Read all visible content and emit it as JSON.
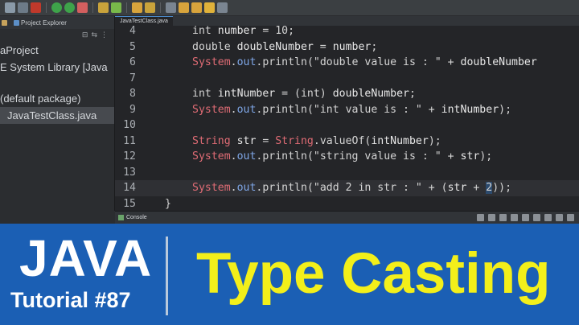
{
  "toolbar": {
    "icons": [
      "new-icon",
      "save-icon",
      "debug-icon",
      "run-icon",
      "external-tools-icon",
      "new-java-project-icon",
      "new-package-icon",
      "new-class-icon",
      "open-type-icon",
      "search-icon",
      "toggle-mark-icon",
      "next-annotation-icon",
      "prev-annotation-icon",
      "back-icon",
      "forward-icon"
    ]
  },
  "sidebar": {
    "tabs": [
      {
        "label": ""
      },
      {
        "label": "Project Explorer"
      }
    ],
    "items": [
      {
        "label": "aProject",
        "indent": 0,
        "selected": false
      },
      {
        "label": "E System Library [Java",
        "indent": 0,
        "selected": false
      },
      {
        "label": "(default package)",
        "indent": 0,
        "selected": false
      },
      {
        "label": "JavaTestClass.java",
        "indent": 1,
        "selected": true
      }
    ]
  },
  "editor": {
    "tab_label": "JavaTestClass.java",
    "lines": [
      {
        "n": "4",
        "parts": [
          [
            "int ",
            "kw"
          ],
          [
            "number",
            "var"
          ],
          [
            " = 10;",
            "kw"
          ]
        ]
      },
      {
        "n": "5",
        "parts": [
          [
            "double ",
            "kw"
          ],
          [
            "doubleNumber",
            "var"
          ],
          [
            " = ",
            "kw"
          ],
          [
            "number",
            "var"
          ],
          [
            ";",
            "kw"
          ]
        ]
      },
      {
        "n": "6",
        "parts": [
          [
            "System",
            "red"
          ],
          [
            ".",
            "kw"
          ],
          [
            "out",
            "blue"
          ],
          [
            ".println(\"double value is : \" + ",
            "kw"
          ],
          [
            "doubleNumber",
            "var"
          ]
        ]
      },
      {
        "n": "7",
        "parts": []
      },
      {
        "n": "8",
        "parts": [
          [
            "int ",
            "kw"
          ],
          [
            "intNumber",
            "var"
          ],
          [
            " = (int) ",
            "kw"
          ],
          [
            "doubleNumber",
            "var"
          ],
          [
            ";",
            "kw"
          ]
        ]
      },
      {
        "n": "9",
        "parts": [
          [
            "System",
            "red"
          ],
          [
            ".",
            "kw"
          ],
          [
            "out",
            "blue"
          ],
          [
            ".println(\"int value is : \" + ",
            "kw"
          ],
          [
            "intNumber",
            "var"
          ],
          [
            ");",
            "kw"
          ]
        ]
      },
      {
        "n": "10",
        "parts": []
      },
      {
        "n": "11",
        "parts": [
          [
            "String ",
            "red"
          ],
          [
            "str",
            "var"
          ],
          [
            " = ",
            "kw"
          ],
          [
            "String",
            "red"
          ],
          [
            ".valueOf(",
            "kw"
          ],
          [
            "intNumber",
            "var"
          ],
          [
            ");",
            "kw"
          ]
        ]
      },
      {
        "n": "12",
        "parts": [
          [
            "System",
            "red"
          ],
          [
            ".",
            "kw"
          ],
          [
            "out",
            "blue"
          ],
          [
            ".println(\"string value is : \" + ",
            "kw"
          ],
          [
            "str",
            "var"
          ],
          [
            ");",
            "kw"
          ]
        ]
      },
      {
        "n": "13",
        "parts": []
      },
      {
        "n": "14",
        "parts": [
          [
            "System",
            "red"
          ],
          [
            ".",
            "kw"
          ],
          [
            "out",
            "blue"
          ],
          [
            ".println(\"add 2 in str : \" + (",
            "kw"
          ],
          [
            "str",
            "var"
          ],
          [
            " + ",
            "kw"
          ],
          [
            "2",
            "hl"
          ],
          [
            "));",
            "kw"
          ]
        ],
        "current": true
      },
      {
        "n": "15",
        "parts": []
      }
    ],
    "closing_brace": "}"
  },
  "console": {
    "tab_label": "Console"
  },
  "banner": {
    "title": "JAVA",
    "subtitle": "Tutorial #87",
    "topic": "Type Casting",
    "colors": {
      "background": "#1b5fb4",
      "topic": "#f3ef1a"
    }
  }
}
